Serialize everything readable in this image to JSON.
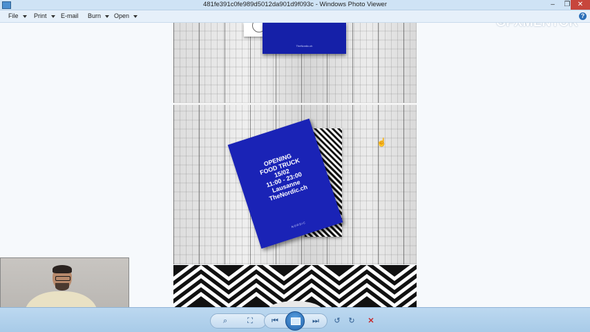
{
  "window": {
    "title": "481fe391c0fe989d5012da901d9f093c - Windows Photo Viewer",
    "minimize_glyph": "–",
    "maximize_glyph": "❐",
    "close_glyph": "✕"
  },
  "menu": {
    "items": [
      {
        "label": "File"
      },
      {
        "label": "Print"
      },
      {
        "label": "E-mail"
      },
      {
        "label": "Burn"
      },
      {
        "label": "Open"
      }
    ],
    "help_glyph": "?"
  },
  "watermark": "GFXMENTOR",
  "photo": {
    "poster_lines": [
      "OPENING",
      "FOOD TRUCK",
      "15/02",
      "11:00 - 23:00",
      "Lausanne",
      "TheNordic.ch"
    ],
    "poster_brand": "NORDIC",
    "top_card_text": "TheNordic.ch"
  },
  "toolbar": {
    "zoom_glyph": "⌕",
    "fit_glyph": "⛶",
    "prev_glyph": "⏮",
    "next_glyph": "⏭",
    "rotate_ccw_glyph": "↺",
    "rotate_cw_glyph": "↻",
    "delete_glyph": "✕"
  },
  "colors": {
    "poster_blue": "#1a23b6",
    "toolbar": "#a8cbe8",
    "titlebar": "#cfe3f5",
    "close_red": "#c7463c"
  }
}
